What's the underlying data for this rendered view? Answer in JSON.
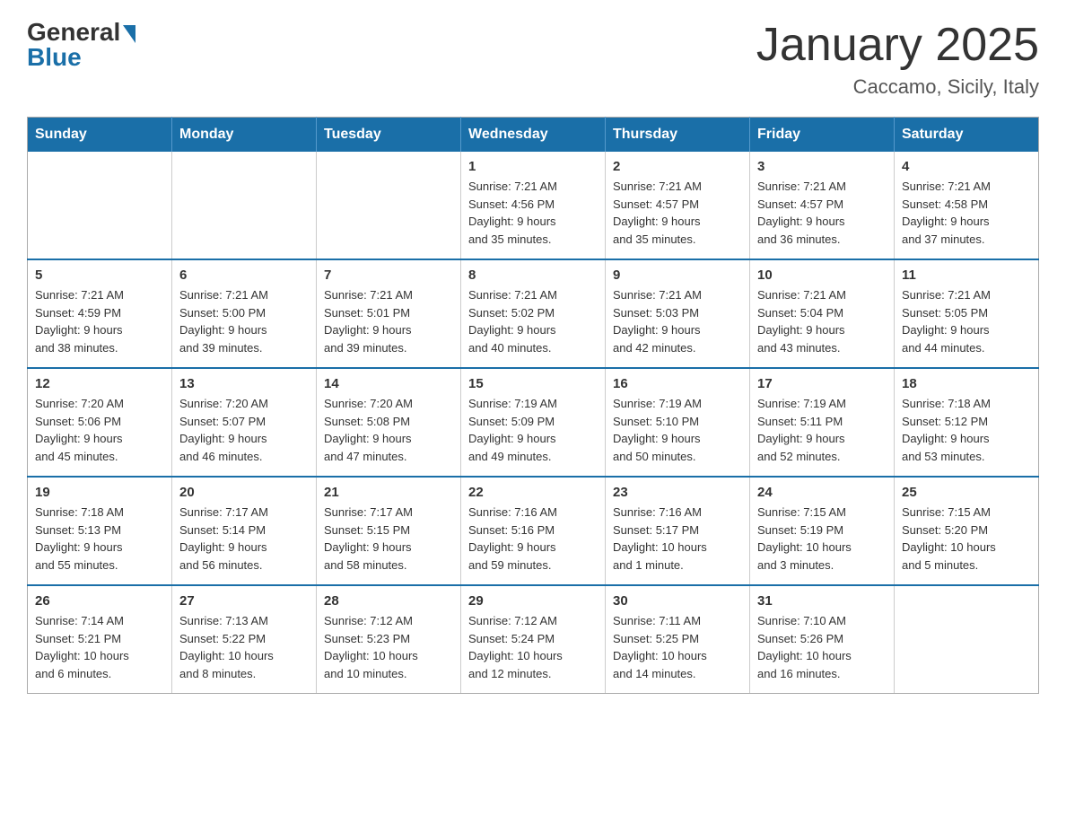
{
  "logo": {
    "general": "General",
    "blue": "Blue"
  },
  "header": {
    "month_year": "January 2025",
    "location": "Caccamo, Sicily, Italy"
  },
  "days_of_week": [
    "Sunday",
    "Monday",
    "Tuesday",
    "Wednesday",
    "Thursday",
    "Friday",
    "Saturday"
  ],
  "weeks": [
    [
      {
        "day": "",
        "info": ""
      },
      {
        "day": "",
        "info": ""
      },
      {
        "day": "",
        "info": ""
      },
      {
        "day": "1",
        "info": "Sunrise: 7:21 AM\nSunset: 4:56 PM\nDaylight: 9 hours\nand 35 minutes."
      },
      {
        "day": "2",
        "info": "Sunrise: 7:21 AM\nSunset: 4:57 PM\nDaylight: 9 hours\nand 35 minutes."
      },
      {
        "day": "3",
        "info": "Sunrise: 7:21 AM\nSunset: 4:57 PM\nDaylight: 9 hours\nand 36 minutes."
      },
      {
        "day": "4",
        "info": "Sunrise: 7:21 AM\nSunset: 4:58 PM\nDaylight: 9 hours\nand 37 minutes."
      }
    ],
    [
      {
        "day": "5",
        "info": "Sunrise: 7:21 AM\nSunset: 4:59 PM\nDaylight: 9 hours\nand 38 minutes."
      },
      {
        "day": "6",
        "info": "Sunrise: 7:21 AM\nSunset: 5:00 PM\nDaylight: 9 hours\nand 39 minutes."
      },
      {
        "day": "7",
        "info": "Sunrise: 7:21 AM\nSunset: 5:01 PM\nDaylight: 9 hours\nand 39 minutes."
      },
      {
        "day": "8",
        "info": "Sunrise: 7:21 AM\nSunset: 5:02 PM\nDaylight: 9 hours\nand 40 minutes."
      },
      {
        "day": "9",
        "info": "Sunrise: 7:21 AM\nSunset: 5:03 PM\nDaylight: 9 hours\nand 42 minutes."
      },
      {
        "day": "10",
        "info": "Sunrise: 7:21 AM\nSunset: 5:04 PM\nDaylight: 9 hours\nand 43 minutes."
      },
      {
        "day": "11",
        "info": "Sunrise: 7:21 AM\nSunset: 5:05 PM\nDaylight: 9 hours\nand 44 minutes."
      }
    ],
    [
      {
        "day": "12",
        "info": "Sunrise: 7:20 AM\nSunset: 5:06 PM\nDaylight: 9 hours\nand 45 minutes."
      },
      {
        "day": "13",
        "info": "Sunrise: 7:20 AM\nSunset: 5:07 PM\nDaylight: 9 hours\nand 46 minutes."
      },
      {
        "day": "14",
        "info": "Sunrise: 7:20 AM\nSunset: 5:08 PM\nDaylight: 9 hours\nand 47 minutes."
      },
      {
        "day": "15",
        "info": "Sunrise: 7:19 AM\nSunset: 5:09 PM\nDaylight: 9 hours\nand 49 minutes."
      },
      {
        "day": "16",
        "info": "Sunrise: 7:19 AM\nSunset: 5:10 PM\nDaylight: 9 hours\nand 50 minutes."
      },
      {
        "day": "17",
        "info": "Sunrise: 7:19 AM\nSunset: 5:11 PM\nDaylight: 9 hours\nand 52 minutes."
      },
      {
        "day": "18",
        "info": "Sunrise: 7:18 AM\nSunset: 5:12 PM\nDaylight: 9 hours\nand 53 minutes."
      }
    ],
    [
      {
        "day": "19",
        "info": "Sunrise: 7:18 AM\nSunset: 5:13 PM\nDaylight: 9 hours\nand 55 minutes."
      },
      {
        "day": "20",
        "info": "Sunrise: 7:17 AM\nSunset: 5:14 PM\nDaylight: 9 hours\nand 56 minutes."
      },
      {
        "day": "21",
        "info": "Sunrise: 7:17 AM\nSunset: 5:15 PM\nDaylight: 9 hours\nand 58 minutes."
      },
      {
        "day": "22",
        "info": "Sunrise: 7:16 AM\nSunset: 5:16 PM\nDaylight: 9 hours\nand 59 minutes."
      },
      {
        "day": "23",
        "info": "Sunrise: 7:16 AM\nSunset: 5:17 PM\nDaylight: 10 hours\nand 1 minute."
      },
      {
        "day": "24",
        "info": "Sunrise: 7:15 AM\nSunset: 5:19 PM\nDaylight: 10 hours\nand 3 minutes."
      },
      {
        "day": "25",
        "info": "Sunrise: 7:15 AM\nSunset: 5:20 PM\nDaylight: 10 hours\nand 5 minutes."
      }
    ],
    [
      {
        "day": "26",
        "info": "Sunrise: 7:14 AM\nSunset: 5:21 PM\nDaylight: 10 hours\nand 6 minutes."
      },
      {
        "day": "27",
        "info": "Sunrise: 7:13 AM\nSunset: 5:22 PM\nDaylight: 10 hours\nand 8 minutes."
      },
      {
        "day": "28",
        "info": "Sunrise: 7:12 AM\nSunset: 5:23 PM\nDaylight: 10 hours\nand 10 minutes."
      },
      {
        "day": "29",
        "info": "Sunrise: 7:12 AM\nSunset: 5:24 PM\nDaylight: 10 hours\nand 12 minutes."
      },
      {
        "day": "30",
        "info": "Sunrise: 7:11 AM\nSunset: 5:25 PM\nDaylight: 10 hours\nand 14 minutes."
      },
      {
        "day": "31",
        "info": "Sunrise: 7:10 AM\nSunset: 5:26 PM\nDaylight: 10 hours\nand 16 minutes."
      },
      {
        "day": "",
        "info": ""
      }
    ]
  ]
}
